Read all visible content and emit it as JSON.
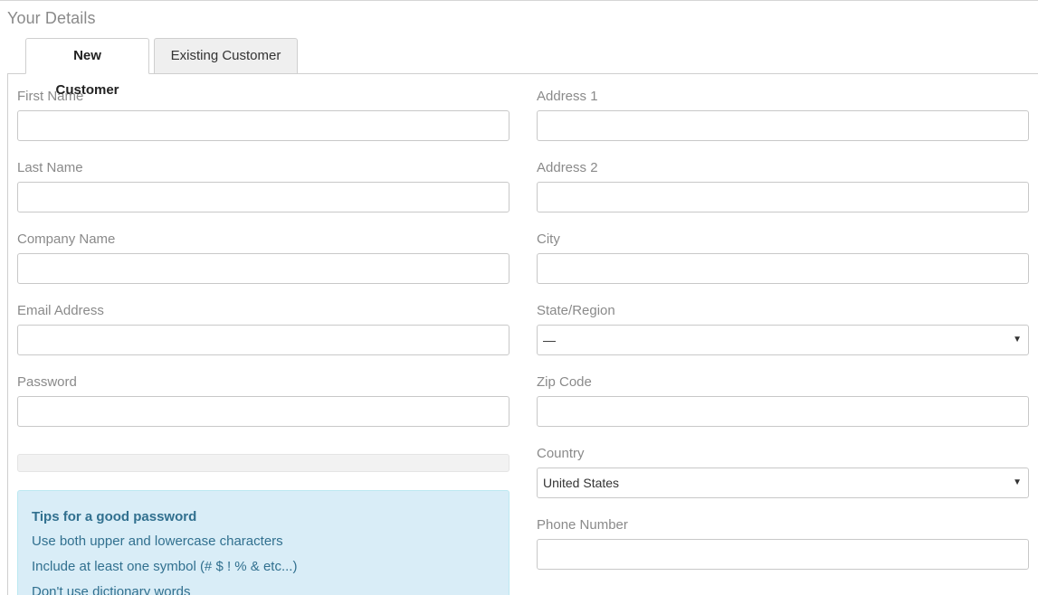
{
  "section": {
    "title": "Your Details"
  },
  "tabs": [
    {
      "label": "New Customer"
    },
    {
      "label": "Existing Customer"
    }
  ],
  "left_fields": {
    "first_name": {
      "label": "First Name",
      "value": ""
    },
    "last_name": {
      "label": "Last Name",
      "value": ""
    },
    "company_name": {
      "label": "Company Name",
      "value": ""
    },
    "email": {
      "label": "Email Address",
      "value": ""
    },
    "password": {
      "label": "Password",
      "value": ""
    }
  },
  "right_fields": {
    "address1": {
      "label": "Address 1",
      "value": ""
    },
    "address2": {
      "label": "Address 2",
      "value": ""
    },
    "city": {
      "label": "City",
      "value": ""
    },
    "state": {
      "label": "State/Region",
      "selected": "—"
    },
    "zip": {
      "label": "Zip Code",
      "value": ""
    },
    "country": {
      "label": "Country",
      "selected": "United States"
    },
    "phone": {
      "label": "Phone Number",
      "value": ""
    }
  },
  "password_strength": {
    "percent": 0
  },
  "tips": {
    "heading": "Tips for a good password",
    "lines": [
      "Use both upper and lowercase characters",
      "Include at least one symbol (# $ ! % & etc...)",
      "Don't use dictionary words"
    ]
  },
  "icons": {
    "select_arrow": "chevron-down-icon"
  }
}
